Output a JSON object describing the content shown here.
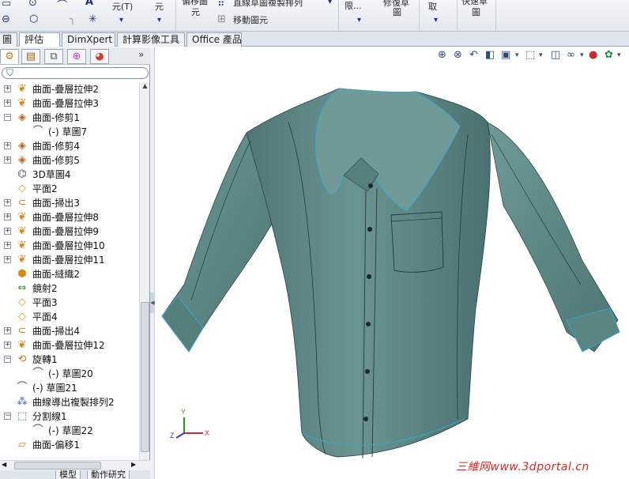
{
  "ribbon": {
    "buttons": [
      {
        "label": "元(T)"
      },
      {
        "label": "元"
      },
      {
        "label": "偏移圖"
      },
      {
        "label": "元"
      },
      {
        "label": "直線草圖複製排列"
      },
      {
        "label": "移動圖元"
      },
      {
        "label": "限..."
      },
      {
        "label": "修復草"
      },
      {
        "label": "圖"
      },
      {
        "label": "取"
      },
      {
        "label": "快速草"
      },
      {
        "label": "圖"
      }
    ]
  },
  "tabs": [
    {
      "label": "圖"
    },
    {
      "label": "評估"
    },
    {
      "label": "DimXpert"
    },
    {
      "label": "計算影像工具"
    },
    {
      "label": "Office 產品"
    }
  ],
  "tree": {
    "items": [
      {
        "label": "曲面-疊層拉伸2",
        "icon": "loft-surface-icon",
        "expandable": true,
        "indent": 0
      },
      {
        "label": "曲面-疊層拉伸3",
        "icon": "loft-surface-icon",
        "expandable": true,
        "indent": 0
      },
      {
        "label": "曲面-修剪1",
        "icon": "trim-surface-icon",
        "expandable": true,
        "expanded": true,
        "indent": 0
      },
      {
        "label": "(-) 草圖7",
        "icon": "sketch-icon",
        "expandable": false,
        "indent": 1
      },
      {
        "label": "曲面-修剪4",
        "icon": "trim-surface-icon",
        "expandable": true,
        "indent": 0
      },
      {
        "label": "曲面-修剪5",
        "icon": "trim-surface-icon",
        "expandable": true,
        "indent": 0
      },
      {
        "label": "3D草圖4",
        "icon": "sketch-3d-icon",
        "expandable": false,
        "indent": 0
      },
      {
        "label": "平面2",
        "icon": "plane-icon",
        "expandable": false,
        "indent": 0
      },
      {
        "label": "曲面-掃出3",
        "icon": "sweep-surface-icon",
        "expandable": true,
        "indent": 0
      },
      {
        "label": "曲面-疊層拉伸8",
        "icon": "loft-surface-icon",
        "expandable": true,
        "indent": 0
      },
      {
        "label": "曲面-疊層拉伸9",
        "icon": "loft-surface-icon",
        "expandable": true,
        "indent": 0
      },
      {
        "label": "曲面-疊層拉伸10",
        "icon": "loft-surface-icon",
        "expandable": true,
        "indent": 0
      },
      {
        "label": "曲面-疊層拉伸11",
        "icon": "loft-surface-icon",
        "expandable": true,
        "indent": 0
      },
      {
        "label": "曲面-縫織2",
        "icon": "knit-surface-icon",
        "expandable": false,
        "indent": 0
      },
      {
        "label": "鏡射2",
        "icon": "mirror-icon",
        "expandable": false,
        "indent": 0
      },
      {
        "label": "平面3",
        "icon": "plane-icon",
        "expandable": false,
        "indent": 0
      },
      {
        "label": "平面4",
        "icon": "plane-icon",
        "expandable": false,
        "indent": 0
      },
      {
        "label": "曲面-掃出4",
        "icon": "sweep-surface-icon",
        "expandable": true,
        "indent": 0
      },
      {
        "label": "曲面-疊層拉伸12",
        "icon": "loft-surface-icon",
        "expandable": true,
        "indent": 0
      },
      {
        "label": "旋轉1",
        "icon": "revolve-icon",
        "expandable": true,
        "expanded": true,
        "indent": 0
      },
      {
        "label": "(-) 草圖20",
        "icon": "sketch-icon",
        "expandable": false,
        "indent": 1
      },
      {
        "label": "(-) 草圖21",
        "icon": "sketch-icon",
        "expandable": false,
        "indent": 0
      },
      {
        "label": "曲線導出複製排列2",
        "icon": "curve-pattern-icon",
        "expandable": false,
        "indent": 0
      },
      {
        "label": "分割線1",
        "icon": "split-line-icon",
        "expandable": true,
        "expanded": true,
        "indent": 0
      },
      {
        "label": "(-) 草圖22",
        "icon": "sketch-icon",
        "expandable": false,
        "indent": 1
      },
      {
        "label": "曲面-偏移1",
        "icon": "offset-surface-icon",
        "expandable": false,
        "indent": 0
      }
    ]
  },
  "bottom_tabs": [
    {
      "label": "模型"
    },
    {
      "label": "動作研究"
    }
  ],
  "viewport": {
    "watermark": "三維网www.3dportal.cn",
    "triad_labels": {
      "x": "X",
      "y": "Y",
      "z": "Z"
    }
  },
  "colors": {
    "shirt_fill": "#5f8a88",
    "shirt_edge": "#3aa6c4",
    "ribbon_bg": "#e8ecf2",
    "watermark": "#e0231f"
  }
}
